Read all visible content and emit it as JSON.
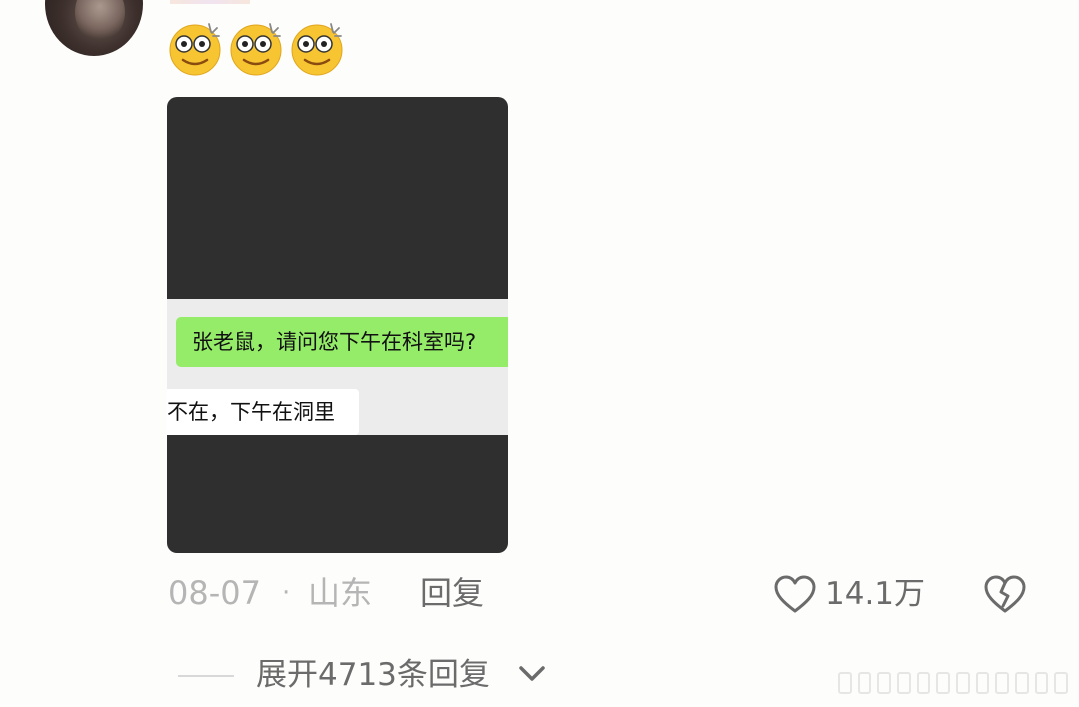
{
  "comment": {
    "avatar_icon": "user-avatar",
    "emoji_icons": [
      "dizzy-face-emoji",
      "dizzy-face-emoji",
      "dizzy-face-emoji"
    ],
    "image": {
      "chat_message_sent": "张老鼠，请问您下午在科室吗?",
      "chat_message_received": "不在，下午在洞里",
      "colors": {
        "dark_background": "#2f2f2f",
        "sent_bubble": "#95ec69",
        "received_bubble": "#ffffff"
      }
    },
    "date": "08-07",
    "separator": "·",
    "location": "山东",
    "reply_label": "回复",
    "like_icon": "heart-outline-icon",
    "like_count": "14.1万",
    "dislike_icon": "broken-heart-icon",
    "expand_replies_label": "展开4713条回复",
    "expand_icon": "chevron-down-icon"
  }
}
